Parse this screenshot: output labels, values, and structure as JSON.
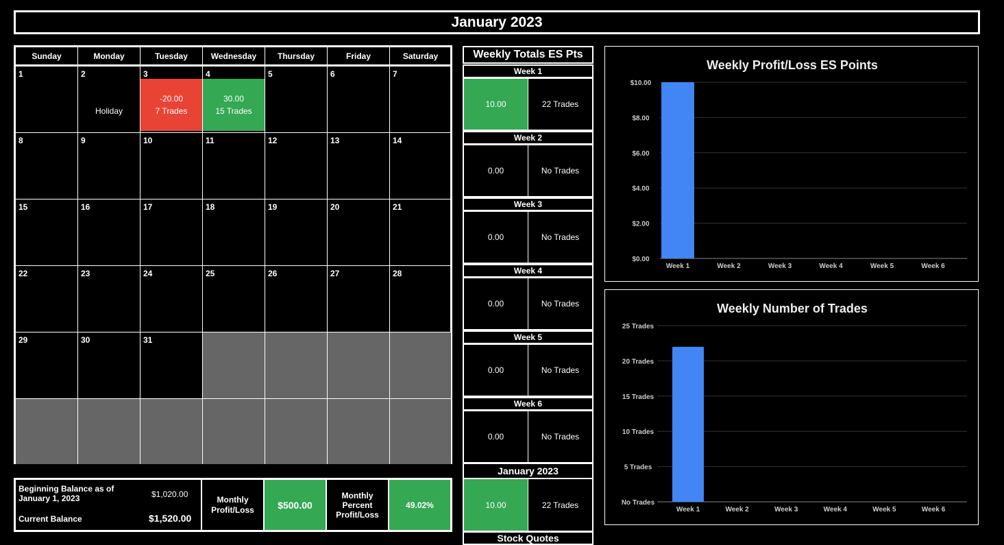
{
  "title": "January 2023",
  "calendar": {
    "day_names": [
      "Sunday",
      "Monday",
      "Tuesday",
      "Wednesday",
      "Thursday",
      "Friday",
      "Saturday"
    ],
    "weeks": [
      [
        {
          "d": "1"
        },
        {
          "d": "2",
          "l1": "",
          "l2": "Holiday"
        },
        {
          "d": "3",
          "l1": "-20.00",
          "l2": "7 Trades",
          "status": "loss"
        },
        {
          "d": "4",
          "l1": "30.00",
          "l2": "15 Trades",
          "status": "win"
        },
        {
          "d": "5"
        },
        {
          "d": "6"
        },
        {
          "d": "7"
        }
      ],
      [
        {
          "d": "8"
        },
        {
          "d": "9"
        },
        {
          "d": "10"
        },
        {
          "d": "11"
        },
        {
          "d": "12"
        },
        {
          "d": "13"
        },
        {
          "d": "14"
        }
      ],
      [
        {
          "d": "15"
        },
        {
          "d": "16"
        },
        {
          "d": "17"
        },
        {
          "d": "18"
        },
        {
          "d": "19"
        },
        {
          "d": "20"
        },
        {
          "d": "21"
        }
      ],
      [
        {
          "d": "22"
        },
        {
          "d": "23"
        },
        {
          "d": "24"
        },
        {
          "d": "25"
        },
        {
          "d": "26"
        },
        {
          "d": "27"
        },
        {
          "d": "28"
        }
      ],
      [
        {
          "d": "29"
        },
        {
          "d": "30"
        },
        {
          "d": "31"
        },
        {
          "empty": true
        },
        {
          "empty": true
        },
        {
          "empty": true
        },
        {
          "empty": true
        }
      ],
      [
        {
          "empty": true
        },
        {
          "empty": true
        },
        {
          "empty": true
        },
        {
          "empty": true
        },
        {
          "empty": true
        },
        {
          "empty": true
        },
        {
          "empty": true
        }
      ]
    ]
  },
  "weekly": {
    "header": "Weekly Totals ES Pts",
    "weeks": [
      {
        "label": "Week 1",
        "value": "10.00",
        "trades": "22 Trades",
        "status": "win"
      },
      {
        "label": "Week 2",
        "value": "0.00",
        "trades": "No Trades"
      },
      {
        "label": "Week 3",
        "value": "0.00",
        "trades": "No Trades"
      },
      {
        "label": "Week 4",
        "value": "0.00",
        "trades": "No Trades"
      },
      {
        "label": "Week 5",
        "value": "0.00",
        "trades": "No Trades"
      },
      {
        "label": "Week 6",
        "value": "0.00",
        "trades": "No Trades"
      }
    ],
    "month": {
      "label": "January 2023",
      "value": "10.00",
      "trades": "22 Trades",
      "status": "win"
    },
    "stock_quotes_label": "Stock Quotes"
  },
  "balance": {
    "beginning_label": "Beginning Balance as of January 1, 2023",
    "beginning_value": "$1,020.00",
    "current_label": "Current Balance",
    "current_value": "$1,520.00",
    "monthly_pl_label": "Monthly Profit/Loss",
    "monthly_pl_value": "$500.00",
    "monthly_pct_label": "Monthly Percent Profit/Loss",
    "monthly_pct_value": "49.02%"
  },
  "colors": {
    "win": "#34a853",
    "loss": "#e94335",
    "bar": "#4285f4",
    "empty": "#666666"
  },
  "chart_data": [
    {
      "type": "bar",
      "title": "Weekly Profit/Loss ES Points",
      "categories": [
        "Week 1",
        "Week 2",
        "Week 3",
        "Week 4",
        "Week 5",
        "Week 6"
      ],
      "values": [
        10,
        0,
        0,
        0,
        0,
        0
      ],
      "ylim": [
        0,
        10
      ],
      "yticks": [
        0,
        2,
        4,
        6,
        8,
        10
      ],
      "ytick_labels": [
        "$0.00",
        "$2.00",
        "$4.00",
        "$6.00",
        "$8.00",
        "$10.00"
      ],
      "grid": true
    },
    {
      "type": "bar",
      "title": "Weekly Number of Trades",
      "categories": [
        "Week 1",
        "Week 2",
        "Week 3",
        "Week 4",
        "Week 5",
        "Week 6"
      ],
      "values": [
        22,
        0,
        0,
        0,
        0,
        0
      ],
      "ylim": [
        0,
        25
      ],
      "yticks": [
        0,
        5,
        10,
        15,
        20,
        25
      ],
      "ytick_labels": [
        "No Trades",
        "5 Trades",
        "10 Trades",
        "15 Trades",
        "20 Trades",
        "25 Trades"
      ],
      "grid": true
    }
  ]
}
